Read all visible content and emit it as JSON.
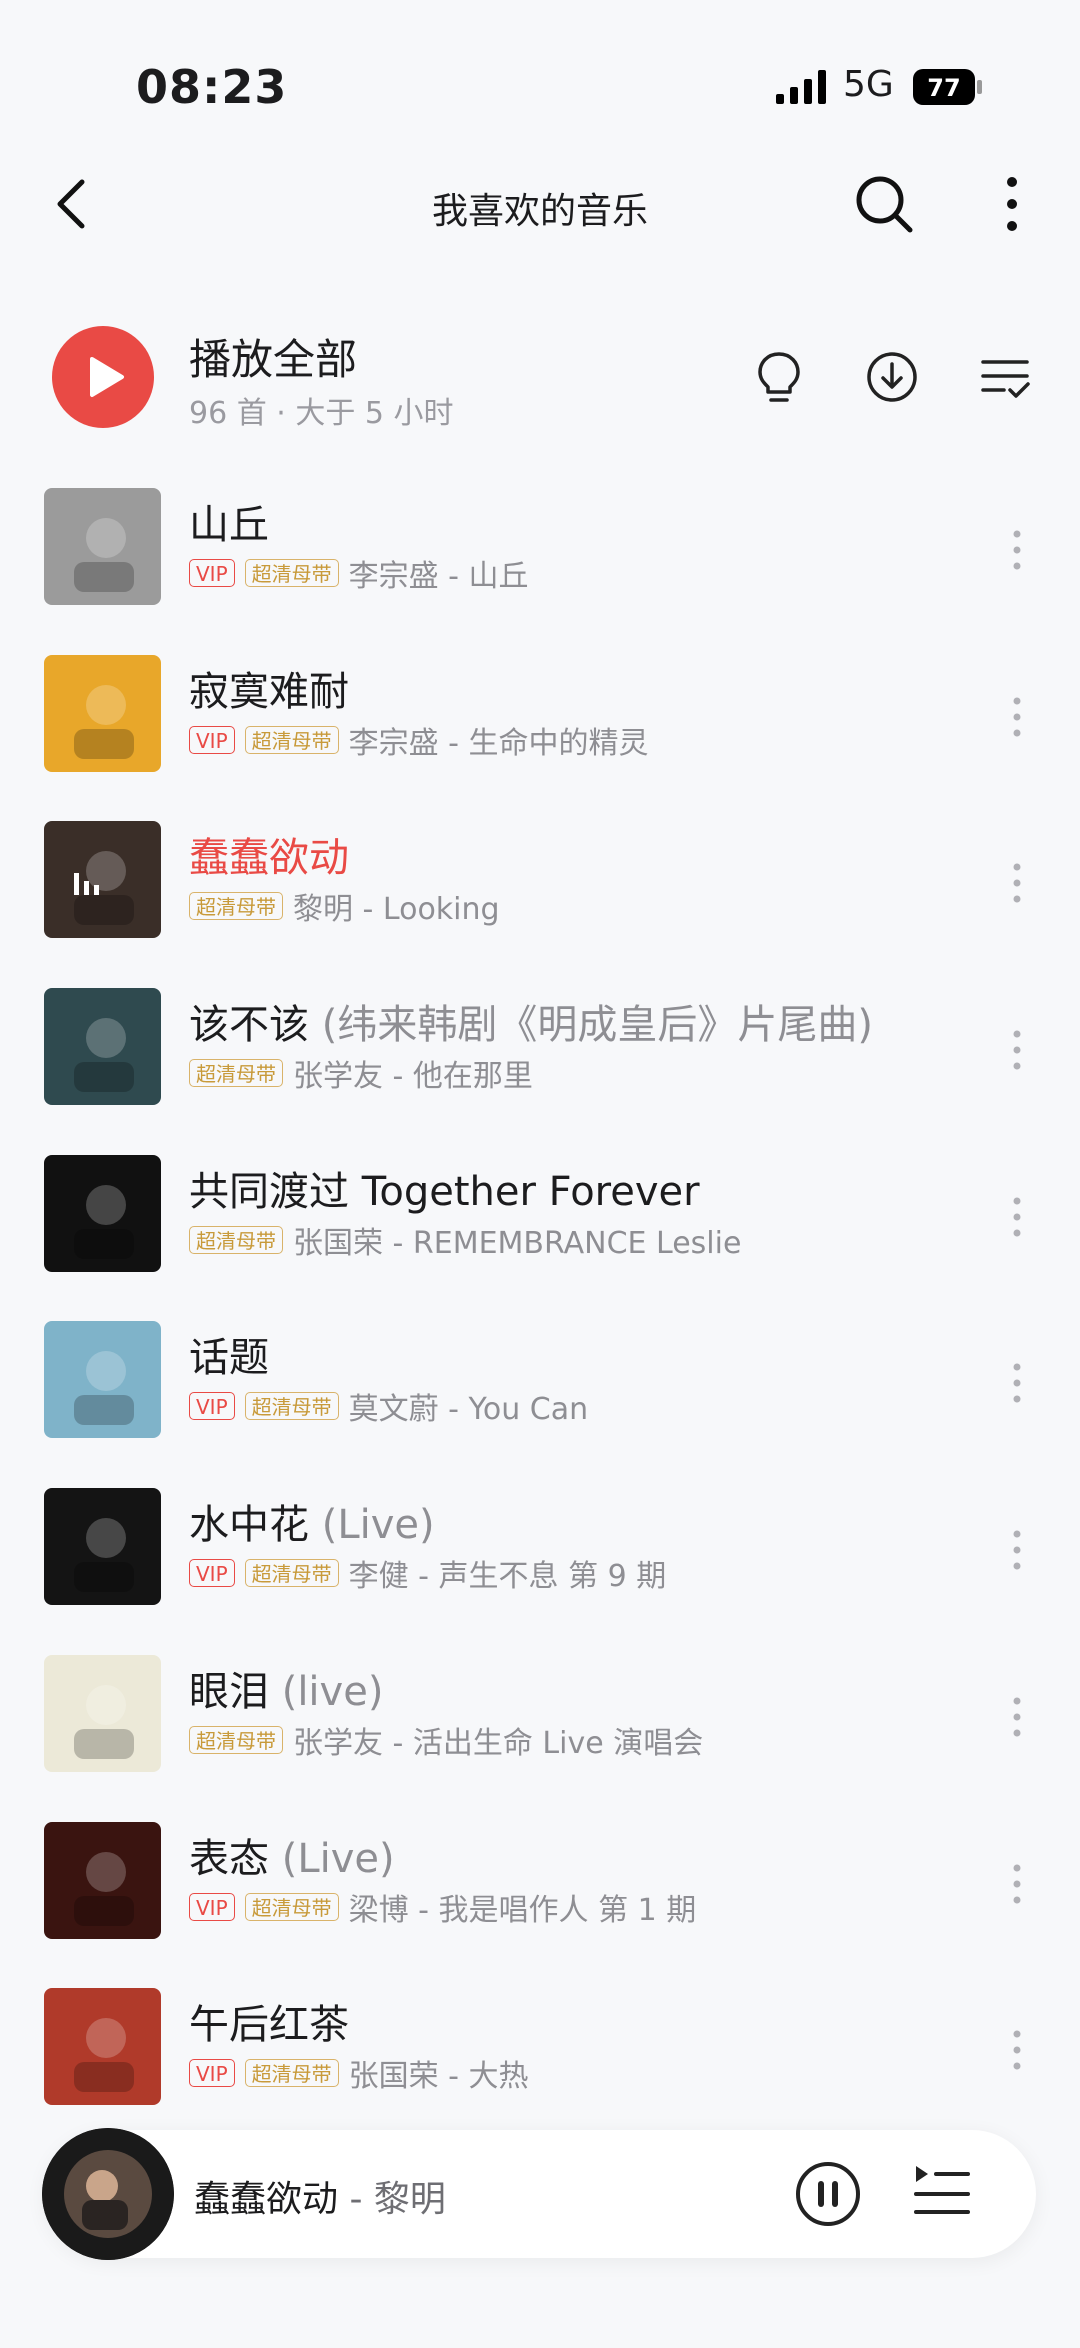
{
  "status_bar": {
    "time": "08:23",
    "network": "5G",
    "battery": "77"
  },
  "nav": {
    "title": "我喜欢的音乐"
  },
  "play_all": {
    "label": "播放全部",
    "subtitle": "96 首 · 大于 5 小时"
  },
  "badges": {
    "vip": "VIP",
    "hq": "超清母带"
  },
  "songs": [
    {
      "title": "山丘",
      "suffix": "",
      "artist": "李宗盛 - 山丘",
      "vip": true,
      "hq": true,
      "playing": false,
      "cover": "#9b9b9b"
    },
    {
      "title": "寂寞难耐",
      "suffix": "",
      "artist": "李宗盛 - 生命中的精灵",
      "vip": true,
      "hq": true,
      "playing": false,
      "cover": "#e8a72a"
    },
    {
      "title": "蠢蠢欲动",
      "suffix": "",
      "artist": "黎明 - Looking",
      "vip": false,
      "hq": true,
      "playing": true,
      "cover": "#3a2e28"
    },
    {
      "title": "该不该",
      "suffix": " (纬来韩剧《明成皇后》片尾曲)",
      "artist": "张学友 - 他在那里",
      "vip": false,
      "hq": true,
      "playing": false,
      "cover": "#2f4a4f"
    },
    {
      "title": "共同渡过 Together Forever",
      "suffix": "",
      "artist": "张国荣 - REMEMBRANCE Leslie",
      "vip": false,
      "hq": true,
      "playing": false,
      "cover": "#111111"
    },
    {
      "title": "话题",
      "suffix": "",
      "artist": "莫文蔚 - You Can",
      "vip": true,
      "hq": true,
      "playing": false,
      "cover": "#7fb3c9"
    },
    {
      "title": "水中花",
      "suffix": " (Live)",
      "artist": "李健 - 声生不息 第 9 期",
      "vip": true,
      "hq": true,
      "playing": false,
      "cover": "#141414"
    },
    {
      "title": "眼泪",
      "suffix": " (live)",
      "artist": "张学友 - 活出生命 Live 演唱会",
      "vip": false,
      "hq": true,
      "playing": false,
      "cover": "#ece9d8"
    },
    {
      "title": "表态",
      "suffix": " (Live)",
      "artist": "梁博 - 我是唱作人 第 1 期",
      "vip": true,
      "hq": true,
      "playing": false,
      "cover": "#3a1410"
    },
    {
      "title": "午后红茶",
      "suffix": "",
      "artist": "张国荣 - 大热",
      "vip": true,
      "hq": true,
      "playing": false,
      "cover": "#b03a2a"
    }
  ],
  "mini_player": {
    "title": "蠢蠢欲动",
    "artist": " - 黎明"
  },
  "colors": {
    "accent": "#e94a45",
    "hq_badge": "#c89a3a",
    "background": "#f7f8fa"
  }
}
